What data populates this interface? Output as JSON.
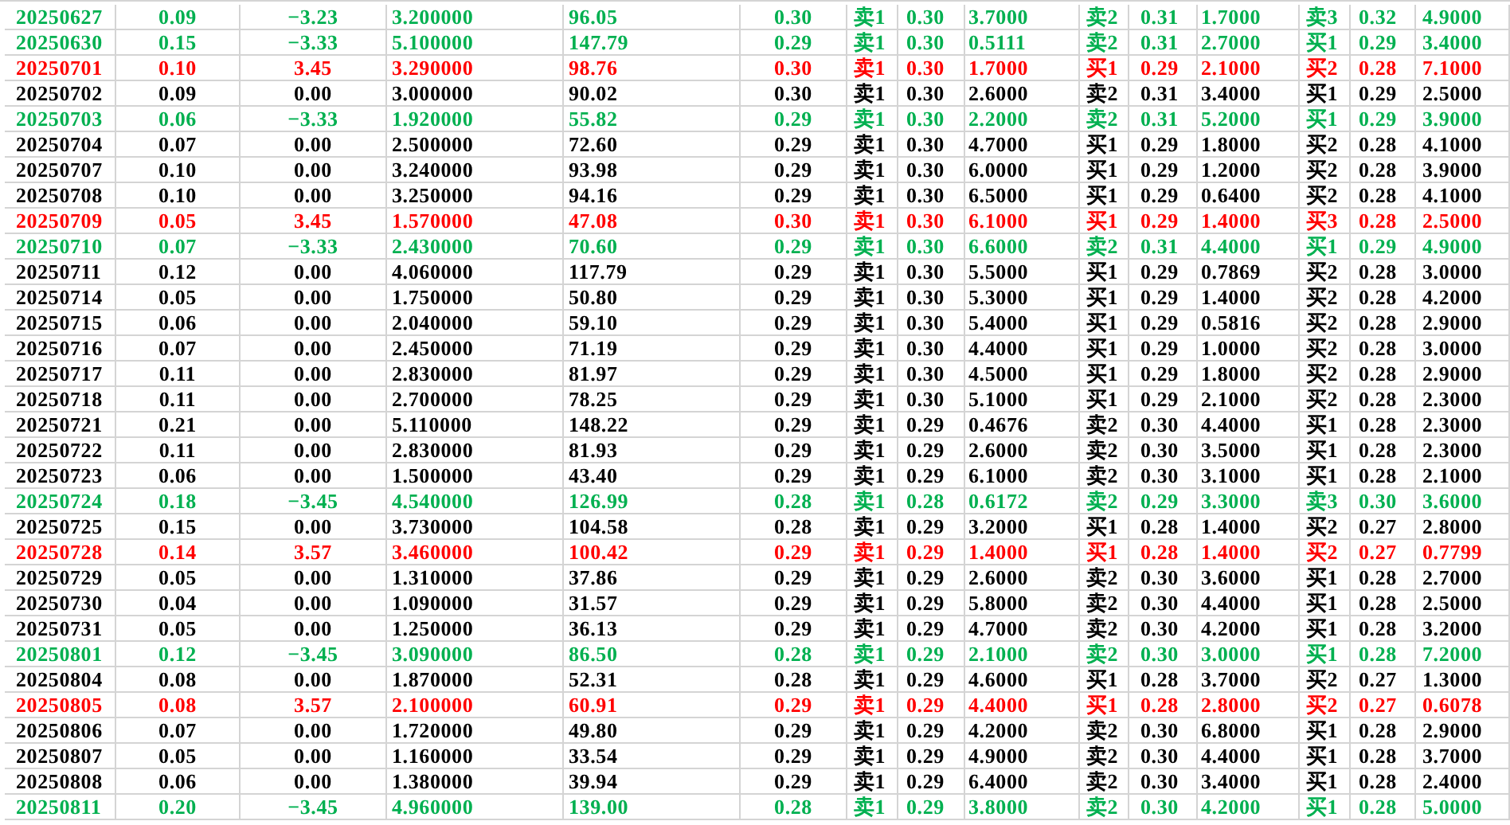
{
  "rows": [
    {
      "color": "#00b050",
      "cells": [
        "20250627",
        "0.09",
        "−3.23",
        "3.200000",
        "96.05",
        "0.30",
        "卖1",
        "0.30",
        "3.7000",
        "卖2",
        "0.31",
        "1.7000",
        "卖3",
        "0.32",
        "4.9000"
      ]
    },
    {
      "color": "#00b050",
      "cells": [
        "20250630",
        "0.15",
        "−3.33",
        "5.100000",
        "147.79",
        "0.29",
        "卖1",
        "0.30",
        "0.5111",
        "卖2",
        "0.31",
        "2.7000",
        "买1",
        "0.29",
        "3.4000"
      ]
    },
    {
      "color": "#ff0000",
      "cells": [
        "20250701",
        "0.10",
        "3.45",
        "3.290000",
        "98.76",
        "0.30",
        "卖1",
        "0.30",
        "1.7000",
        "买1",
        "0.29",
        "2.1000",
        "买2",
        "0.28",
        "7.1000"
      ]
    },
    {
      "color": "#000000",
      "cells": [
        "20250702",
        "0.09",
        "0.00",
        "3.000000",
        "90.02",
        "0.30",
        "卖1",
        "0.30",
        "2.6000",
        "卖2",
        "0.31",
        "3.4000",
        "买1",
        "0.29",
        "2.5000"
      ]
    },
    {
      "color": "#00b050",
      "cells": [
        "20250703",
        "0.06",
        "−3.33",
        "1.920000",
        "55.82",
        "0.29",
        "卖1",
        "0.30",
        "2.2000",
        "卖2",
        "0.31",
        "5.2000",
        "买1",
        "0.29",
        "3.9000"
      ]
    },
    {
      "color": "#000000",
      "cells": [
        "20250704",
        "0.07",
        "0.00",
        "2.500000",
        "72.60",
        "0.29",
        "卖1",
        "0.30",
        "4.7000",
        "买1",
        "0.29",
        "1.8000",
        "买2",
        "0.28",
        "4.1000"
      ]
    },
    {
      "color": "#000000",
      "cells": [
        "20250707",
        "0.10",
        "0.00",
        "3.240000",
        "93.98",
        "0.29",
        "卖1",
        "0.30",
        "6.0000",
        "买1",
        "0.29",
        "1.2000",
        "买2",
        "0.28",
        "3.9000"
      ]
    },
    {
      "color": "#000000",
      "cells": [
        "20250708",
        "0.10",
        "0.00",
        "3.250000",
        "94.16",
        "0.29",
        "卖1",
        "0.30",
        "6.5000",
        "买1",
        "0.29",
        "0.6400",
        "买2",
        "0.28",
        "4.1000"
      ]
    },
    {
      "color": "#ff0000",
      "cells": [
        "20250709",
        "0.05",
        "3.45",
        "1.570000",
        "47.08",
        "0.30",
        "卖1",
        "0.30",
        "6.1000",
        "买1",
        "0.29",
        "1.4000",
        "买3",
        "0.28",
        "2.5000"
      ]
    },
    {
      "color": "#00b050",
      "cells": [
        "20250710",
        "0.07",
        "−3.33",
        "2.430000",
        "70.60",
        "0.29",
        "卖1",
        "0.30",
        "6.6000",
        "卖2",
        "0.31",
        "4.4000",
        "买1",
        "0.29",
        "4.9000"
      ]
    },
    {
      "color": "#000000",
      "cells": [
        "20250711",
        "0.12",
        "0.00",
        "4.060000",
        "117.79",
        "0.29",
        "卖1",
        "0.30",
        "5.5000",
        "买1",
        "0.29",
        "0.7869",
        "买2",
        "0.28",
        "3.0000"
      ]
    },
    {
      "color": "#000000",
      "cells": [
        "20250714",
        "0.05",
        "0.00",
        "1.750000",
        "50.80",
        "0.29",
        "卖1",
        "0.30",
        "5.3000",
        "买1",
        "0.29",
        "1.4000",
        "买2",
        "0.28",
        "4.2000"
      ]
    },
    {
      "color": "#000000",
      "cells": [
        "20250715",
        "0.06",
        "0.00",
        "2.040000",
        "59.10",
        "0.29",
        "卖1",
        "0.30",
        "5.4000",
        "买1",
        "0.29",
        "0.5816",
        "买2",
        "0.28",
        "2.9000"
      ]
    },
    {
      "color": "#000000",
      "cells": [
        "20250716",
        "0.07",
        "0.00",
        "2.450000",
        "71.19",
        "0.29",
        "卖1",
        "0.30",
        "4.4000",
        "买1",
        "0.29",
        "1.0000",
        "买2",
        "0.28",
        "3.0000"
      ]
    },
    {
      "color": "#000000",
      "cells": [
        "20250717",
        "0.11",
        "0.00",
        "2.830000",
        "81.97",
        "0.29",
        "卖1",
        "0.30",
        "4.5000",
        "买1",
        "0.29",
        "1.8000",
        "买2",
        "0.28",
        "2.9000"
      ]
    },
    {
      "color": "#000000",
      "cells": [
        "20250718",
        "0.11",
        "0.00",
        "2.700000",
        "78.25",
        "0.29",
        "卖1",
        "0.30",
        "5.1000",
        "买1",
        "0.29",
        "2.1000",
        "买2",
        "0.28",
        "2.3000"
      ]
    },
    {
      "color": "#000000",
      "cells": [
        "20250721",
        "0.21",
        "0.00",
        "5.110000",
        "148.22",
        "0.29",
        "卖1",
        "0.29",
        "0.4676",
        "卖2",
        "0.30",
        "4.4000",
        "买1",
        "0.28",
        "2.3000"
      ]
    },
    {
      "color": "#000000",
      "cells": [
        "20250722",
        "0.11",
        "0.00",
        "2.830000",
        "81.93",
        "0.29",
        "卖1",
        "0.29",
        "2.6000",
        "卖2",
        "0.30",
        "3.5000",
        "买1",
        "0.28",
        "2.3000"
      ]
    },
    {
      "color": "#000000",
      "cells": [
        "20250723",
        "0.06",
        "0.00",
        "1.500000",
        "43.40",
        "0.29",
        "卖1",
        "0.29",
        "6.1000",
        "卖2",
        "0.30",
        "3.1000",
        "买1",
        "0.28",
        "2.1000"
      ]
    },
    {
      "color": "#00b050",
      "cells": [
        "20250724",
        "0.18",
        "−3.45",
        "4.540000",
        "126.99",
        "0.28",
        "卖1",
        "0.28",
        "0.6172",
        "卖2",
        "0.29",
        "3.3000",
        "卖3",
        "0.30",
        "3.6000"
      ]
    },
    {
      "color": "#000000",
      "cells": [
        "20250725",
        "0.15",
        "0.00",
        "3.730000",
        "104.58",
        "0.28",
        "卖1",
        "0.29",
        "3.2000",
        "买1",
        "0.28",
        "1.4000",
        "买2",
        "0.27",
        "2.8000"
      ]
    },
    {
      "color": "#ff0000",
      "cells": [
        "20250728",
        "0.14",
        "3.57",
        "3.460000",
        "100.42",
        "0.29",
        "卖1",
        "0.29",
        "1.4000",
        "买1",
        "0.28",
        "1.4000",
        "买2",
        "0.27",
        "0.7799"
      ]
    },
    {
      "color": "#000000",
      "cells": [
        "20250729",
        "0.05",
        "0.00",
        "1.310000",
        "37.86",
        "0.29",
        "卖1",
        "0.29",
        "2.6000",
        "卖2",
        "0.30",
        "3.6000",
        "买1",
        "0.28",
        "2.7000"
      ]
    },
    {
      "color": "#000000",
      "cells": [
        "20250730",
        "0.04",
        "0.00",
        "1.090000",
        "31.57",
        "0.29",
        "卖1",
        "0.29",
        "5.8000",
        "卖2",
        "0.30",
        "4.4000",
        "买1",
        "0.28",
        "2.5000"
      ]
    },
    {
      "color": "#000000",
      "cells": [
        "20250731",
        "0.05",
        "0.00",
        "1.250000",
        "36.13",
        "0.29",
        "卖1",
        "0.29",
        "4.7000",
        "卖2",
        "0.30",
        "4.2000",
        "买1",
        "0.28",
        "3.2000"
      ]
    },
    {
      "color": "#00b050",
      "cells": [
        "20250801",
        "0.12",
        "−3.45",
        "3.090000",
        "86.50",
        "0.28",
        "卖1",
        "0.29",
        "2.1000",
        "卖2",
        "0.30",
        "3.0000",
        "买1",
        "0.28",
        "7.2000"
      ]
    },
    {
      "color": "#000000",
      "cells": [
        "20250804",
        "0.08",
        "0.00",
        "1.870000",
        "52.31",
        "0.28",
        "卖1",
        "0.29",
        "4.6000",
        "买1",
        "0.28",
        "3.7000",
        "买2",
        "0.27",
        "1.3000"
      ]
    },
    {
      "color": "#ff0000",
      "cells": [
        "20250805",
        "0.08",
        "3.57",
        "2.100000",
        "60.91",
        "0.29",
        "卖1",
        "0.29",
        "4.4000",
        "买1",
        "0.28",
        "2.8000",
        "买2",
        "0.27",
        "0.6078"
      ]
    },
    {
      "color": "#000000",
      "cells": [
        "20250806",
        "0.07",
        "0.00",
        "1.720000",
        "49.80",
        "0.29",
        "卖1",
        "0.29",
        "4.2000",
        "卖2",
        "0.30",
        "6.8000",
        "买1",
        "0.28",
        "2.9000"
      ]
    },
    {
      "color": "#000000",
      "cells": [
        "20250807",
        "0.05",
        "0.00",
        "1.160000",
        "33.54",
        "0.29",
        "卖1",
        "0.29",
        "4.9000",
        "卖2",
        "0.30",
        "4.4000",
        "买1",
        "0.28",
        "3.7000"
      ]
    },
    {
      "color": "#000000",
      "cells": [
        "20250808",
        "0.06",
        "0.00",
        "1.380000",
        "39.94",
        "0.29",
        "卖1",
        "0.29",
        "6.4000",
        "卖2",
        "0.30",
        "3.4000",
        "买1",
        "0.28",
        "2.4000"
      ]
    },
    {
      "color": "#00b050",
      "cells": [
        "20250811",
        "0.20",
        "−3.45",
        "4.960000",
        "139.00",
        "0.28",
        "卖1",
        "0.29",
        "3.8000",
        "卖2",
        "0.30",
        "4.2000",
        "买1",
        "0.28",
        "5.0000"
      ]
    }
  ]
}
